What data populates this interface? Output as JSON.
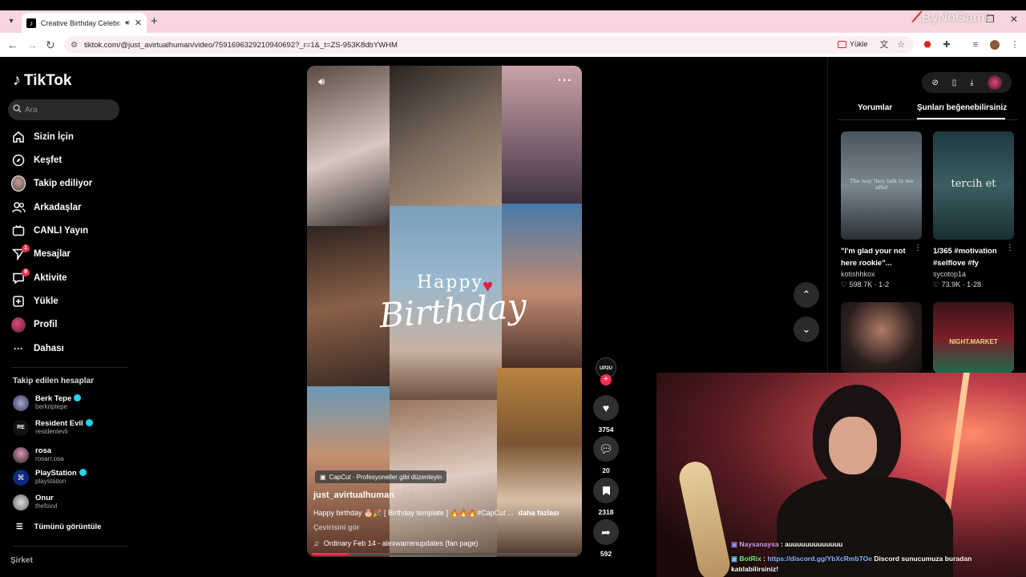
{
  "browser": {
    "tab_title": "Creative Birthday Celebratio",
    "url": "tiktok.com/@just_avirtualhuman/video/7591696329210940692?_r=1&_t=ZS-953K8dbYWHM",
    "upload_label": "Yükle",
    "overlay_logo": "ByNoGame"
  },
  "sidebar": {
    "logo": "TikTok",
    "search_placeholder": "Ara",
    "nav": [
      {
        "label": "Sizin İçin",
        "icon": "home-icon"
      },
      {
        "label": "Keşfet",
        "icon": "compass-icon"
      },
      {
        "label": "Takip ediliyor",
        "icon": "following-avatar-icon"
      },
      {
        "label": "Arkadaşlar",
        "icon": "friends-icon"
      },
      {
        "label": "CANLI Yayın",
        "icon": "live-icon"
      },
      {
        "label": "Mesajlar",
        "icon": "messages-icon",
        "badge": "1"
      },
      {
        "label": "Aktivite",
        "icon": "activity-icon",
        "badge": "9"
      },
      {
        "label": "Yükle",
        "icon": "upload-icon"
      },
      {
        "label": "Profil",
        "icon": "profile-avatar-icon"
      },
      {
        "label": "Dahası",
        "icon": "more-icon"
      }
    ],
    "followed_title": "Takip edilen hesaplar",
    "accounts": [
      {
        "name": "Berk Tepe",
        "handle": "berkriptepe",
        "verified": true
      },
      {
        "name": "Resident Evil",
        "handle": "residentevil",
        "verified": true
      },
      {
        "name": "rosa",
        "handle": "rosarr.osa",
        "verified": false
      },
      {
        "name": "PlayStation",
        "handle": "playstation",
        "verified": true
      },
      {
        "name": "Onur",
        "handle": "thefoxvl",
        "verified": false
      }
    ],
    "see_all": "Tümünü görüntüle",
    "company": "Şirket"
  },
  "video": {
    "overlay_line1": "Happy",
    "overlay_line2": "Birthday",
    "capcut_label": "CapCut · Profesyoneller gibi düzenleyin",
    "author": "just_avirtualhuman",
    "age": "· 1-5",
    "description": "Happy birthday 🎂🎉 [ Birthday template ] 🔥🔥🔥#CapCut ...",
    "more": "daha fazlası",
    "translate": "Çevirisini gör",
    "music": "Ordinary Feb 14 - alexwarrenupdates (fan page)",
    "progress_fraction": 0.14,
    "creator_tag": "UP2U",
    "likes": "3754",
    "comments": "20",
    "saves": "2318",
    "shares": "592"
  },
  "right_panel": {
    "tab_comments": "Yorumlar",
    "tab_suggested": "Şunları beğenebilirsiniz",
    "cards": [
      {
        "title": "\"I'm glad your not here rookie\"...",
        "user": "kotishhkox",
        "likes": "598.7K",
        "age": "1-2",
        "thumb_text": "The way they talk to me after"
      },
      {
        "title": "1/365 #motivation #selflove #fy",
        "user": "sycotop1a",
        "likes": "73.9K",
        "age": "1-28",
        "thumb_text": "tercih et"
      },
      {
        "title": "",
        "user": "",
        "likes": "",
        "age": "",
        "thumb_text": ""
      },
      {
        "title": "",
        "user": "",
        "likes": "",
        "age": "",
        "thumb_text": "NIGHT.MARKET"
      }
    ]
  },
  "stream_chat": [
    {
      "user": "Naysanaysa",
      "message": ": auuuuuuuuuuuuu"
    },
    {
      "user": "BotRix",
      "link": "https://discord.gg/YbXcRmbTOe",
      "message": "Discord sunucumuza buradan katılabilirsiniz!"
    }
  ],
  "colors": {
    "accent": "#fe2c55",
    "verified": "#20d5ec",
    "tabbar": "#f7d6e0"
  }
}
